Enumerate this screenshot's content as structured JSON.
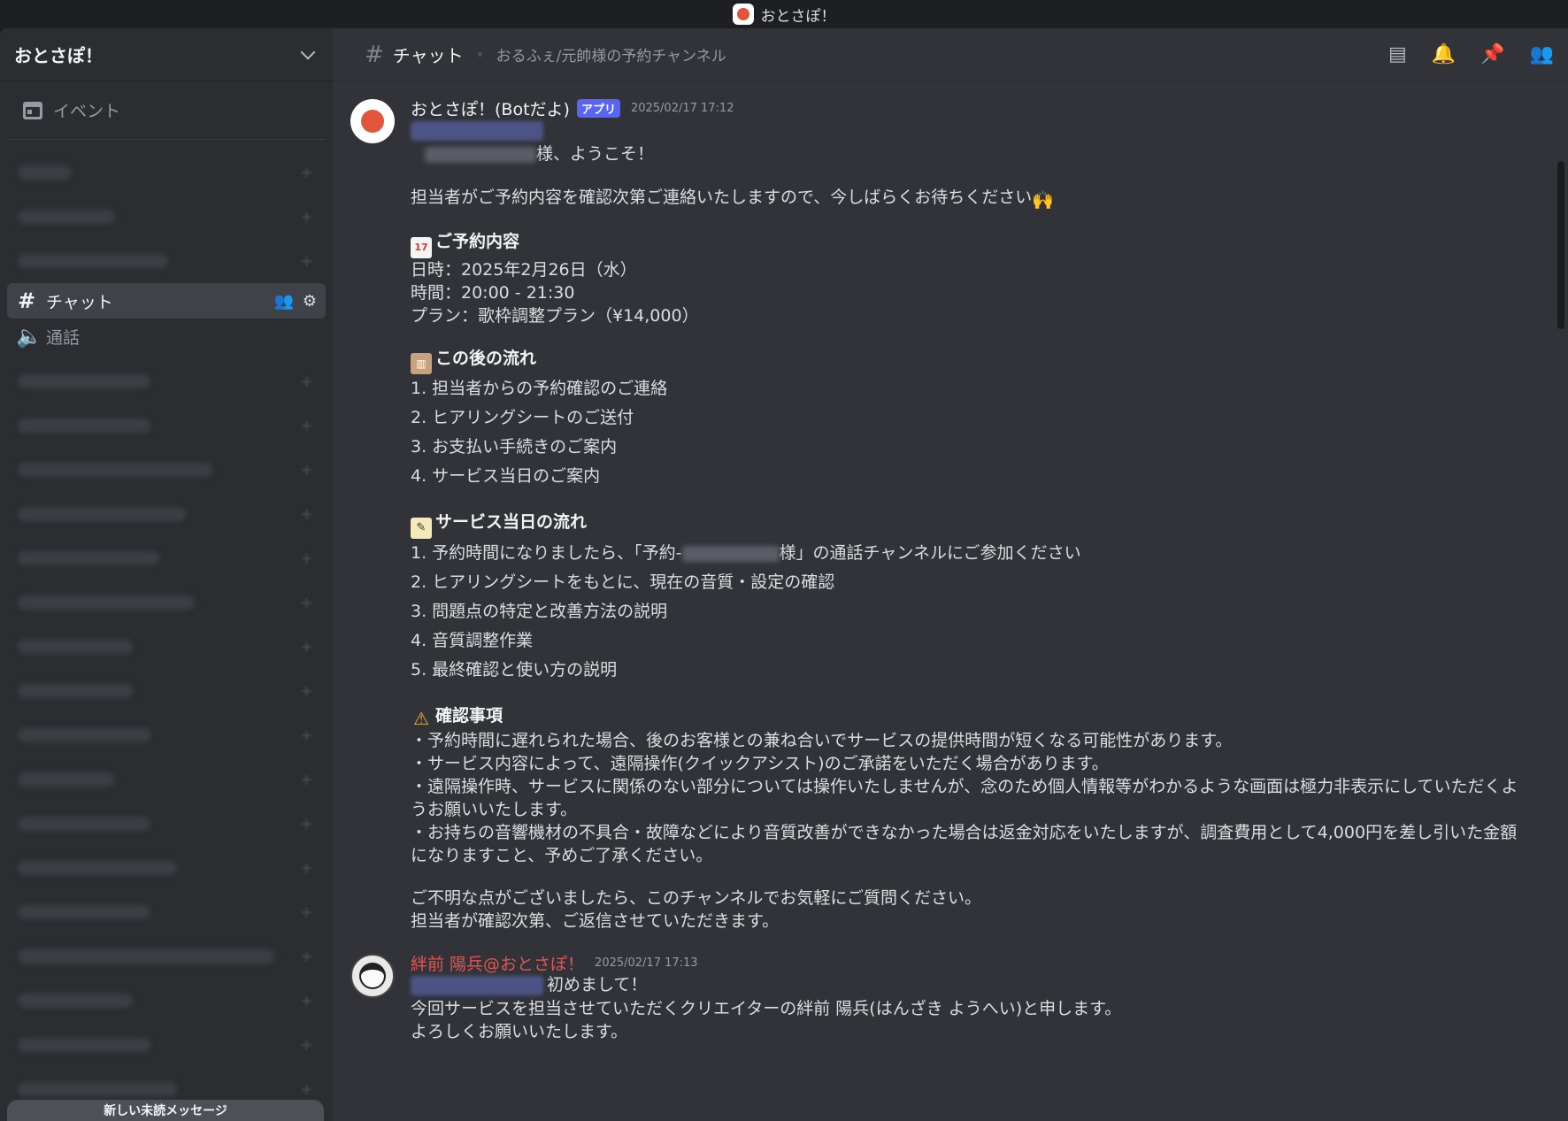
{
  "window": {
    "title": "おとさぽ！"
  },
  "server": {
    "name": "おとさぽ！"
  },
  "sidebar": {
    "events_label": "イベント",
    "active_channel": "チャット",
    "voice_channel": "通話",
    "unread_banner": "新しい未読メッセージ"
  },
  "header": {
    "channel_name": "チャット",
    "topic": "おるふぇ/元帥様の予約チャンネル"
  },
  "messages": [
    {
      "author": "おとさぽ！(Botだよ)",
      "badge": "アプリ",
      "timestamp": "2025/02/17 17:12",
      "greeting_suffix": "様、ようこそ！",
      "intro": "担当者がご予約内容を確認次第ご連絡いたしますので、今しばらくお待ちください",
      "reservation_heading": "ご予約内容",
      "reservation_lines": [
        "日時：2025年2月26日（水）",
        "時間：20:00 - 21:30",
        "プラン：歌枠調整プラン（¥14,000）"
      ],
      "flow_heading": "この後の流れ",
      "flow_lines": [
        "1. 担当者からの予約確認のご連絡",
        "2. ヒアリングシートのご送付",
        "3. お支払い手続きのご案内",
        "4. サービス当日のご案内"
      ],
      "day_heading": "サービス当日の流れ",
      "day_line1_prefix": "1. 予約時間になりましたら、「予約-",
      "day_line1_suffix": "様」の通話チャンネルにご参加ください",
      "day_lines": [
        "2. ヒアリングシートをもとに、現在の音質・設定の確認",
        "3. 問題点の特定と改善方法の説明",
        "4. 音質調整作業",
        "5. 最終確認と使い方の説明"
      ],
      "confirm_heading": "確認事項",
      "confirm_lines": [
        "・予約時間に遅れられた場合、後のお客様との兼ね合いでサービスの提供時間が短くなる可能性があります。",
        "・サービス内容によって、遠隔操作(クイックアシスト)のご承諾をいただく場合があります。",
        "・遠隔操作時、サービスに関係のない部分については操作いたしませんが、念のため個人情報等がわかるような画面は極力非表示にしていただくようお願いいたします。",
        "・お持ちの音響機材の不具合・故障などにより音質改善ができなかった場合は返金対応をいたしますが、調査費用として4,000円を差し引いた金額になりますこと、予めご了承ください。"
      ],
      "closing_lines": [
        "ご不明な点がございましたら、このチャンネルでお気軽にご質問ください。",
        "担当者が確認次第、ご返信させていただきます。"
      ]
    },
    {
      "author": "絆前 陽兵@おとさぽ！",
      "timestamp": "2025/02/17 17:13",
      "first_suffix": "初めまして！",
      "lines": [
        "今回サービスを担当させていただくクリエイターの絆前 陽兵(はんざき ようへい)と申します。",
        "よろしくお願いいたします。"
      ]
    }
  ],
  "icons": {
    "threads": "threads-icon",
    "bell": "bell-icon",
    "pin": "pin-icon",
    "members": "members-icon"
  },
  "colors": {
    "accent": "#5865f2",
    "author_red": "#e55454",
    "bg_main": "#313338",
    "bg_sidebar": "#2b2d31"
  }
}
